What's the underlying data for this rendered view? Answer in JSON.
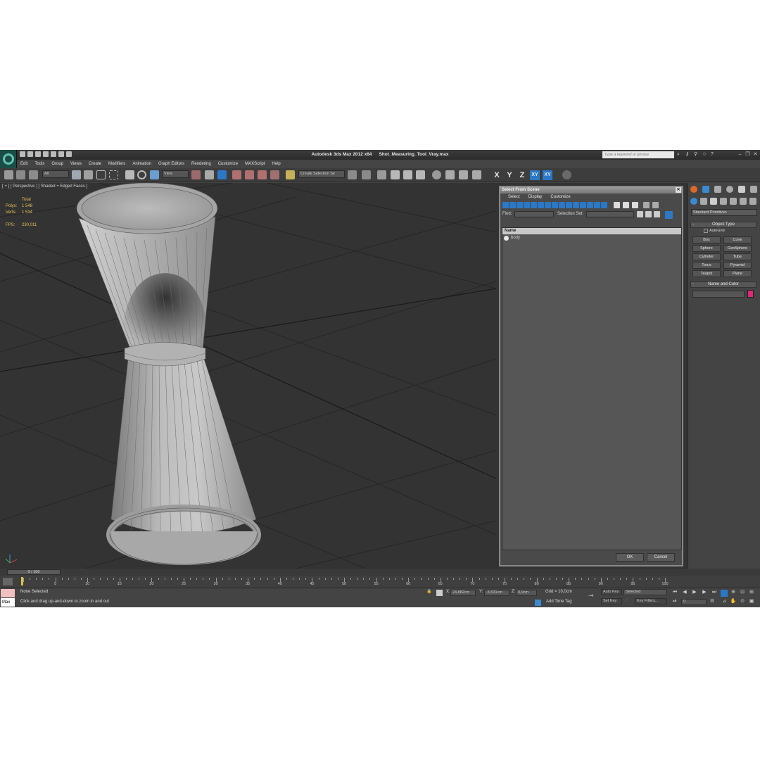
{
  "window": {
    "app_name": "Autodesk 3ds Max  2012 x64",
    "file_name": "Shot_Measuring_Tool_Vray.max",
    "search_placeholder": "Type a keyword or phrase"
  },
  "menu": [
    "Edit",
    "Tools",
    "Group",
    "Views",
    "Create",
    "Modifiers",
    "Animation",
    "Graph Editors",
    "Rendering",
    "Customize",
    "MAXScript",
    "Help"
  ],
  "toolbar": {
    "selection_filter": "All",
    "reference_coord": "View",
    "selection_set": "Create Selection Se",
    "axis_x": "X",
    "axis_y": "Y",
    "axis_z": "Z",
    "axis_xy": "XY",
    "axis_xy2": "XY"
  },
  "viewport": {
    "label": "[ + ] [ Perspective ] [ Shaded + Edged Faces ]",
    "stats_header": "Total",
    "polys_label": "Polys:",
    "polys_value": "1 548",
    "verts_label": "Verts:",
    "verts_value": "1 534",
    "fps_label": "FPS:",
    "fps_value": "230,011"
  },
  "dialog": {
    "title": "Select From Scene",
    "menu": [
      "Select",
      "Display",
      "Customize"
    ],
    "find_label": "Find:",
    "selection_set_label": "Selection Set:",
    "column_name": "Name",
    "objects": [
      "body"
    ],
    "ok": "OK",
    "cancel": "Cancel"
  },
  "command_panel": {
    "category": "Standard Primitives",
    "object_type": "Object Type",
    "autogrid": "AutoGrid",
    "primitives": [
      "Box",
      "Cone",
      "Sphere",
      "GeoSphere",
      "Cylinder",
      "Tube",
      "Torus",
      "Pyramid",
      "Teapot",
      "Plane"
    ],
    "name_and_color": "Name and Color",
    "swatch_color": "#e0287a"
  },
  "timeline": {
    "frame_readout": "0 / 100",
    "ticks": [
      "0",
      "5",
      "10",
      "15",
      "20",
      "25",
      "30",
      "35",
      "40",
      "45",
      "50",
      "55",
      "60",
      "65",
      "70",
      "75",
      "80",
      "85",
      "90",
      "95",
      "100"
    ]
  },
  "status": {
    "selection": "None Selected",
    "prompt": "Click and drag up-and-down to zoom in and out",
    "maxscript": "Max",
    "x_label": "X:",
    "x_value": "24,882cm",
    "y_label": "Y:",
    "y_value": "-5,531cm",
    "z_label": "Z:",
    "z_value": "0,0cm",
    "grid": "Grid = 10,0cm",
    "add_time_tag": "Add Time Tag",
    "auto_key": "Auto Key",
    "set_key": "Set Key",
    "key_mode": "Selected",
    "key_filters": "Key Filters...",
    "frame": "0"
  }
}
